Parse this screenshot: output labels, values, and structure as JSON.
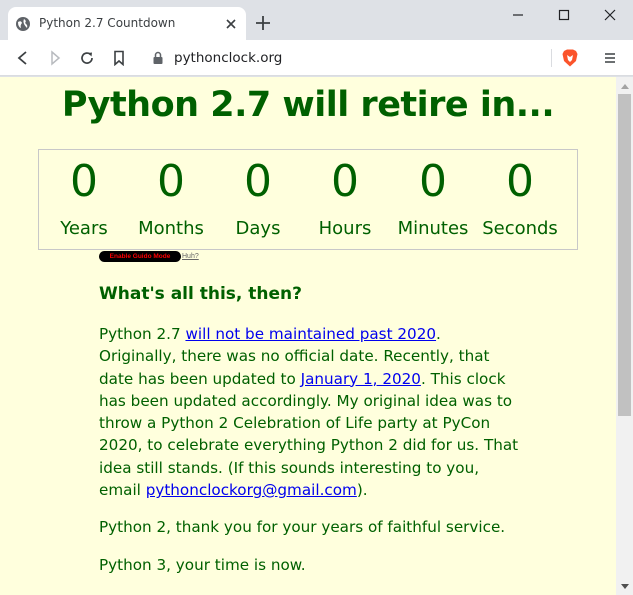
{
  "browser": {
    "tab_title": "Python 2.7 Countdown",
    "url": "pythonclock.org"
  },
  "page": {
    "headline": "Python 2.7 will retire in...",
    "countdown": [
      {
        "value": "0",
        "label": "Years"
      },
      {
        "value": "0",
        "label": "Months"
      },
      {
        "value": "0",
        "label": "Days"
      },
      {
        "value": "0",
        "label": "Hours"
      },
      {
        "value": "0",
        "label": "Minutes"
      },
      {
        "value": "0",
        "label": "Seconds"
      }
    ],
    "guido_button": "Enable Guido Mode",
    "huh_link": "Huh?",
    "section_heading": "What's all this, then?",
    "p1": {
      "t1": "Python 2.7 ",
      "link1": "will not be maintained past 2020",
      "t2": ". Originally, there was no official date. Recently, that date has been updated to ",
      "link2": "January 1, 2020",
      "t3": ". This clock has been updated accordingly. My original idea was to throw a Python 2 Celebration of Life party at PyCon 2020, to celebrate everything Python 2 did for us. That idea still stands. (If this sounds interesting to you, email ",
      "email": "pythonclockorg@gmail.com",
      "t4": ")."
    },
    "p2": "Python 2, thank you for your years of faithful service.",
    "p3": "Python 3, your time is now."
  },
  "colors": {
    "page_bg": "#ffffdd",
    "text_green": "#006000",
    "link_blue": "#0000ee",
    "guido_text": "#ff0000",
    "brave_orange": "#fb542b"
  },
  "icons": [
    "globe-icon",
    "close-icon",
    "plus-icon",
    "minimize-icon",
    "maximize-icon",
    "window-close-icon",
    "back-arrow-icon",
    "forward-arrow-icon",
    "reload-icon",
    "bookmark-icon",
    "lock-icon",
    "brave-lion-icon",
    "kebab-menu-icon",
    "scroll-up-icon",
    "scroll-down-icon"
  ]
}
